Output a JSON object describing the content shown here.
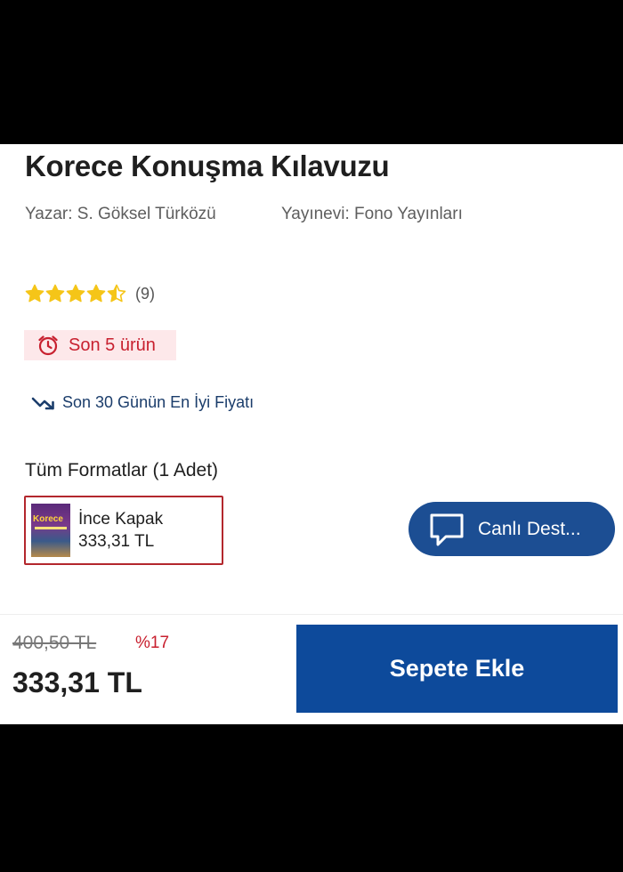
{
  "product": {
    "title": "Korece Konuşma Kılavuzu",
    "author": "S. Göksel Türközü",
    "author_label": "Yazar:",
    "publisher": "Fono Yayınları",
    "publisher_label": "Yayınevi:"
  },
  "rating": {
    "value": 4.5,
    "max": 5,
    "count_text": "(9)",
    "star_color": "#f5c518"
  },
  "stock": {
    "text": "Son 5 ürün",
    "icon": "alarm-clock-icon",
    "color": "#c8202f"
  },
  "best_price": {
    "text": "Son 30 Günün En İyi Fiyatı",
    "icon": "trending-down-icon"
  },
  "formats": {
    "title": "Tüm Formatlar (1 Adet)",
    "items": [
      {
        "name": "İnce Kapak",
        "price": "333,31 TL",
        "cover_text": "Korece"
      }
    ]
  },
  "chat": {
    "label": "Canlı Dest...",
    "icon": "chat-bubble-icon"
  },
  "bottom_bar": {
    "old_price": "400,50 TL",
    "discount": "%17",
    "current_price": "333,31 TL",
    "add_to_cart_label": "Sepete Ekle",
    "button_color": "#0d4a9b"
  }
}
